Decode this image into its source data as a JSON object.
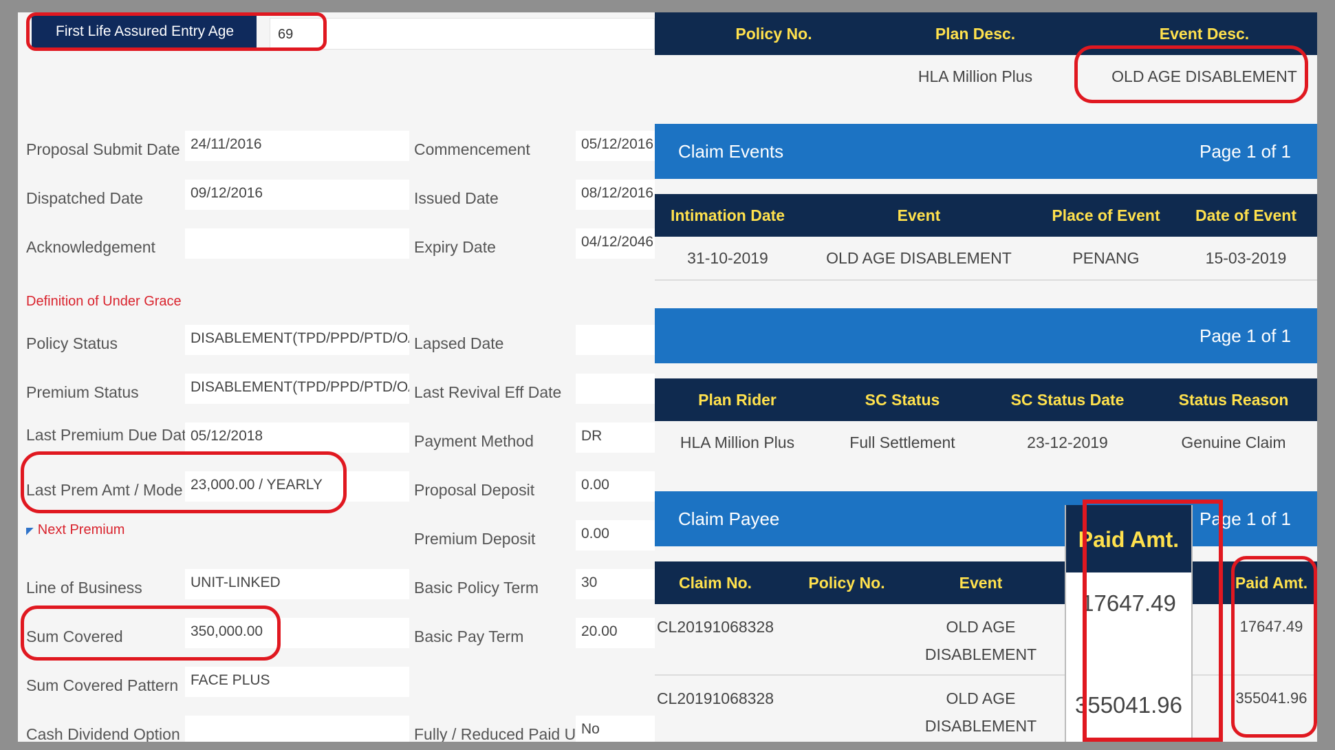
{
  "left": {
    "entry_age": {
      "label": "First Life Assured Entry Age",
      "value": "69"
    },
    "fields": {
      "proposal_submit_date": {
        "label": "Proposal Submit Date",
        "value": "24/11/2016"
      },
      "commencement": {
        "label": "Commencement",
        "value": "05/12/2016"
      },
      "dispatched_date": {
        "label": "Dispatched Date",
        "value": "09/12/2016"
      },
      "issued_date": {
        "label": "Issued Date",
        "value": "08/12/2016"
      },
      "acknowledgement": {
        "label": "Acknowledgement",
        "value": ""
      },
      "expiry_date": {
        "label": "Expiry Date",
        "value": "04/12/2046"
      },
      "definition_under_grace": {
        "label": "Definition of Under Grace"
      },
      "policy_status": {
        "label": "Policy Status",
        "value": "DISABLEMENT(TPD/PPD/PTD/OAD)"
      },
      "lapsed_date": {
        "label": "Lapsed Date",
        "value": ""
      },
      "premium_status": {
        "label": "Premium Status",
        "value": "DISABLEMENT(TPD/PPD/PTD/OAD)"
      },
      "last_revival_eff_date": {
        "label": "Last Revival Eff Date",
        "value": ""
      },
      "last_premium_due_date": {
        "label": "Last Premium Due Date",
        "value": "05/12/2018"
      },
      "payment_method": {
        "label": "Payment Method",
        "value": "DR"
      },
      "last_prem_amt_mode": {
        "label": "Last Prem Amt / Mode",
        "value": "23,000.00 / YEARLY"
      },
      "proposal_deposit": {
        "label": "Proposal Deposit",
        "value": "0.00"
      },
      "next_premium": {
        "label": "Next Premium"
      },
      "premium_deposit": {
        "label": "Premium Deposit",
        "value": "0.00"
      },
      "line_of_business": {
        "label": "Line of Business",
        "value": "UNIT-LINKED"
      },
      "basic_policy_term": {
        "label": "Basic Policy Term",
        "value": "30"
      },
      "sum_covered": {
        "label": "Sum Covered",
        "value": "350,000.00"
      },
      "basic_pay_term": {
        "label": "Basic Pay Term",
        "value": "20.00"
      },
      "sum_covered_pattern": {
        "label": "Sum Covered Pattern",
        "value": "FACE PLUS"
      },
      "cash_dividend_option": {
        "label": "Cash Dividend Option",
        "value": ""
      },
      "fully_reduced_paid_up": {
        "label": "Fully / Reduced Paid Up",
        "value": "No"
      }
    }
  },
  "right": {
    "policy_table": {
      "headers": [
        "Policy No.",
        "Plan Desc.",
        "Event Desc."
      ],
      "row": [
        "",
        "HLA Million Plus",
        "OLD AGE DISABLEMENT"
      ]
    },
    "claim_events": {
      "title": "Claim Events",
      "page": "Page 1 of 1",
      "headers": [
        "Intimation Date",
        "Event",
        "Place of Event",
        "Date of Event"
      ],
      "row": [
        "31-10-2019",
        "OLD AGE DISABLEMENT",
        "PENANG",
        "15-03-2019"
      ]
    },
    "rider_bar": {
      "page": "Page 1 of 1"
    },
    "rider_table": {
      "headers": [
        "Plan Rider",
        "SC Status",
        "SC Status Date",
        "Status Reason"
      ],
      "row": [
        "HLA Million Plus",
        "Full Settlement",
        "23-12-2019",
        "Genuine Claim"
      ]
    },
    "claim_payee": {
      "title": "Claim Payee",
      "page": "Page 1 of 1",
      "headers": [
        "Claim No.",
        "Policy No.",
        "Event",
        "Paid Amt."
      ],
      "rows": [
        {
          "claim_no": "CL20191068328",
          "policy_no": "",
          "event_line1": "OLD AGE",
          "event_line2": "DISABLEMENT",
          "paid": "17647.49"
        },
        {
          "claim_no": "CL20191068328",
          "policy_no": "",
          "event_line1": "OLD AGE",
          "event_line2": "DISABLEMENT",
          "paid": "355041.96"
        }
      ]
    },
    "paid_popup": {
      "header": "Paid Amt.",
      "values": [
        "17647.49",
        "355041.96"
      ]
    }
  },
  "colors": {
    "navy": "#0f2a4f",
    "blue": "#1c73c3",
    "yellow": "#ffe14d",
    "red": "#e01820"
  }
}
